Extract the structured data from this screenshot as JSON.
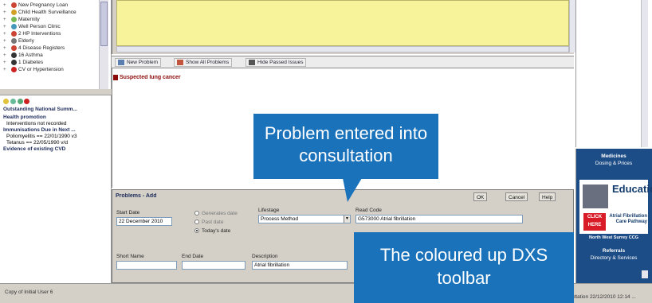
{
  "left_tree": {
    "items": [
      {
        "plus": "+",
        "label": "New Pregnancy Loan",
        "icon_color": "#c43"
      },
      {
        "plus": "+",
        "label": "Child Health Surveillance",
        "icon_color": "#d2a227"
      },
      {
        "plus": "+",
        "label": "Maternity",
        "icon_color": "#7b5"
      },
      {
        "plus": "+",
        "label": "Well Person Clinic",
        "icon_color": "#49b"
      },
      {
        "plus": "+",
        "label": "2 HP Interventions",
        "icon_color": "#c43"
      },
      {
        "plus": "+",
        "label": "Elderly",
        "icon_color": "#777"
      },
      {
        "plus": "+",
        "label": "4 Disease Registers",
        "icon_color": "#c43"
      },
      {
        "plus": "+",
        "label": "16 Asthma",
        "icon_color": "#333"
      },
      {
        "plus": "+",
        "label": "1 Diabetes",
        "icon_color": "#333"
      },
      {
        "plus": "+",
        "label": "CV or Hypertension",
        "icon_color": "#c22"
      }
    ]
  },
  "summary": {
    "title": "Outstanding National Summ...",
    "health_promotion": "Health promotion",
    "intervention": "Interventions not recorded",
    "immunisations": "Immunisations Due in Next ...",
    "polio": "Poliomyelitis == 22/01/1990 v3",
    "tetanus": "Tetanus == 22/05/1990 v/d",
    "cvd": "Evidence of existing CVD"
  },
  "problems": {
    "toolbar": {
      "new_problem": "New Problem",
      "show_all": "Show All Problems",
      "hide_past": "Hide Passed Issues"
    },
    "items": [
      "Suspected lung cancer"
    ]
  },
  "dialog": {
    "title": "Problems - Add",
    "ok": "OK",
    "cancel": "Cancel",
    "help": "Help",
    "start_date_label": "Start Date",
    "start_date_value": "22 December 2010",
    "radio_1": "Generates date",
    "radio_2": "Past date",
    "radio_3": "Today's date",
    "lifestage_label": "Lifestage",
    "lifestage_value": "Process Method",
    "read_code_label": "Read Code",
    "read_code_value": "G573000 Atrial fibrillation",
    "short_name_label": "Short Name",
    "end_date_label": "End Date",
    "description_label": "Description",
    "description_value": "Atrial fibrillation"
  },
  "status": {
    "left": "Copy of Initial User 6",
    "right": "Consultation 22/12/2010 12:14 ..."
  },
  "right_panel": {
    "medicines_title": "Medicines",
    "medicines_sub": "Dosing & Prices",
    "education": "Education",
    "click_here": "CLICK HERE",
    "af_text": "Atrial Fibrillation Care Pathway",
    "ccg": "North West Surrey CCG",
    "referrals_title": "Referrals",
    "referrals_sub": "Directory & Services"
  },
  "callouts": {
    "problem_entered": "Problem entered into consultation",
    "dxs_toolbar": "The coloured up DXS toolbar"
  },
  "colors": {
    "callout": "#1a72bb",
    "yellow_area": "#f7f39a",
    "problem_text": "#8b0a0a",
    "right_panel": "#1d4d86"
  }
}
